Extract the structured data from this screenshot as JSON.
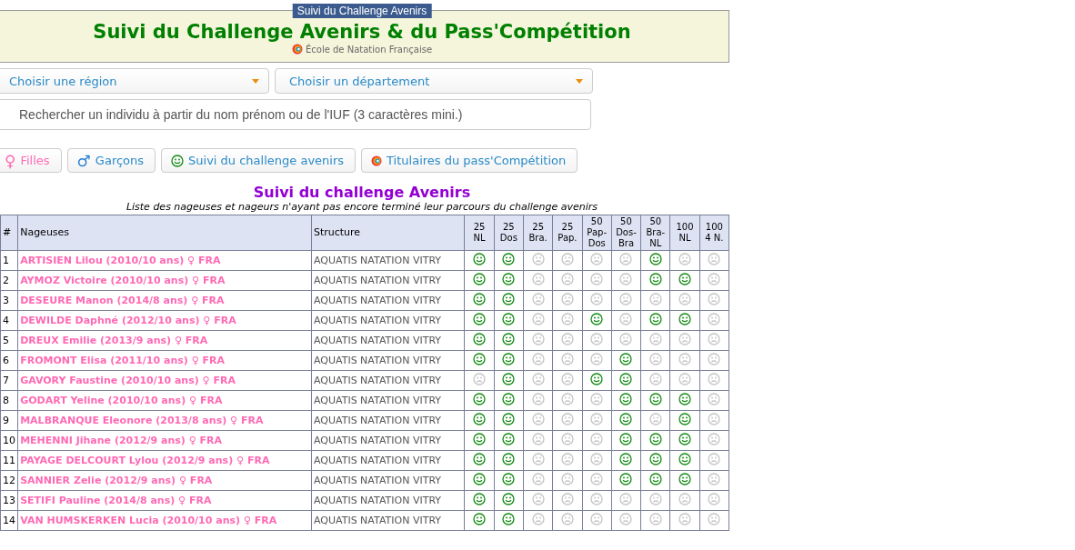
{
  "header": {
    "tag": "Suivi du Challenge Avenirs",
    "title": "Suivi du Challenge Avenirs & du Pass'Compétition",
    "subtitle": "École de Natation Française"
  },
  "filters": [
    {
      "placeholder": "Choisir une région"
    },
    {
      "placeholder": "Choisir un département"
    }
  ],
  "search": {
    "placeholder": "Rechercher un individu à partir du nom prénom ou de l'IUF (3 caractères mini.)"
  },
  "buttons": [
    {
      "kind": "female",
      "label": "Filles",
      "icon": "♀"
    },
    {
      "kind": "male",
      "label": "Garçons",
      "icon": "♂"
    },
    {
      "kind": "smiley",
      "label": "Suivi du challenge avenirs"
    },
    {
      "kind": "logo",
      "label": "Titulaires du pass'Compétition"
    }
  ],
  "section": {
    "title": "Suivi du challenge Avenirs",
    "subtitle": "Liste des nageuses et nageurs n'ayant pas encore terminé leur parcours du challenge avenirs"
  },
  "table": {
    "columns": [
      "#",
      "Nageuses",
      "Structure",
      [
        "25",
        "NL"
      ],
      [
        "25",
        "Dos"
      ],
      [
        "25",
        "Bra."
      ],
      [
        "25",
        "Pap."
      ],
      [
        "50",
        "Pap-",
        "Dos"
      ],
      [
        "50",
        "Dos-",
        "Bra"
      ],
      [
        "50",
        "Bra-",
        "NL"
      ],
      [
        "100",
        "NL"
      ],
      [
        "100",
        "4 N."
      ]
    ],
    "rows": [
      {
        "num": "1",
        "swimmer": "ARTISIEN Lilou (2010/10 ans) ♀ FRA",
        "structure": "AQUATIS NATATION VITRY",
        "passed": [
          true,
          true,
          false,
          false,
          false,
          false,
          true,
          false,
          false
        ]
      },
      {
        "num": "2",
        "swimmer": "AYMOZ Victoire (2010/10 ans) ♀ FRA",
        "structure": "AQUATIS NATATION VITRY",
        "passed": [
          true,
          true,
          false,
          false,
          false,
          false,
          true,
          true,
          false
        ]
      },
      {
        "num": "3",
        "swimmer": "DESEURE Manon (2014/8 ans) ♀ FRA",
        "structure": "AQUATIS NATATION VITRY",
        "passed": [
          true,
          true,
          false,
          false,
          false,
          false,
          false,
          false,
          false
        ]
      },
      {
        "num": "4",
        "swimmer": "DEWILDE Daphné (2012/10 ans) ♀ FRA",
        "structure": "AQUATIS NATATION VITRY",
        "passed": [
          true,
          true,
          false,
          false,
          true,
          false,
          true,
          true,
          false
        ]
      },
      {
        "num": "5",
        "swimmer": "DREUX Emilie (2013/9 ans) ♀ FRA",
        "structure": "AQUATIS NATATION VITRY",
        "passed": [
          true,
          true,
          false,
          false,
          false,
          false,
          false,
          false,
          false
        ]
      },
      {
        "num": "6",
        "swimmer": "FROMONT Elisa (2011/10 ans) ♀ FRA",
        "structure": "AQUATIS NATATION VITRY",
        "passed": [
          true,
          true,
          false,
          false,
          false,
          true,
          false,
          false,
          false
        ]
      },
      {
        "num": "7",
        "swimmer": "GAVORY Faustine (2010/10 ans) ♀ FRA",
        "structure": "AQUATIS NATATION VITRY",
        "passed": [
          false,
          true,
          false,
          false,
          true,
          true,
          false,
          false,
          false
        ]
      },
      {
        "num": "8",
        "swimmer": "GODART Yeline (2010/10 ans) ♀ FRA",
        "structure": "AQUATIS NATATION VITRY",
        "passed": [
          true,
          true,
          false,
          false,
          false,
          true,
          true,
          true,
          false
        ]
      },
      {
        "num": "9",
        "swimmer": "MALBRANQUE Eleonore (2013/8 ans) ♀ FRA",
        "structure": "AQUATIS NATATION VITRY",
        "passed": [
          true,
          true,
          false,
          false,
          false,
          true,
          false,
          true,
          false
        ]
      },
      {
        "num": "10",
        "swimmer": "MEHENNI Jihane (2012/9 ans) ♀ FRA",
        "structure": "AQUATIS NATATION VITRY",
        "passed": [
          true,
          true,
          false,
          false,
          false,
          true,
          true,
          true,
          false
        ]
      },
      {
        "num": "11",
        "swimmer": "PAYAGE DELCOURT Lylou (2012/9 ans) ♀ FRA",
        "structure": "AQUATIS NATATION VITRY",
        "passed": [
          true,
          true,
          false,
          false,
          false,
          true,
          true,
          true,
          false
        ]
      },
      {
        "num": "12",
        "swimmer": "SANNIER Zelie (2012/9 ans) ♀ FRA",
        "structure": "AQUATIS NATATION VITRY",
        "passed": [
          true,
          true,
          false,
          false,
          false,
          true,
          true,
          true,
          false
        ]
      },
      {
        "num": "13",
        "swimmer": "SETIFI Pauline (2014/8 ans) ♀ FRA",
        "structure": "AQUATIS NATATION VITRY",
        "passed": [
          true,
          true,
          false,
          false,
          false,
          false,
          false,
          false,
          false
        ]
      },
      {
        "num": "14",
        "swimmer": "VAN HUMSKERKEN Lucia (2010/10 ans) ♀ FRA",
        "structure": "AQUATIS NATATION VITRY",
        "passed": [
          true,
          true,
          false,
          false,
          false,
          false,
          false,
          false,
          false
        ]
      }
    ]
  }
}
